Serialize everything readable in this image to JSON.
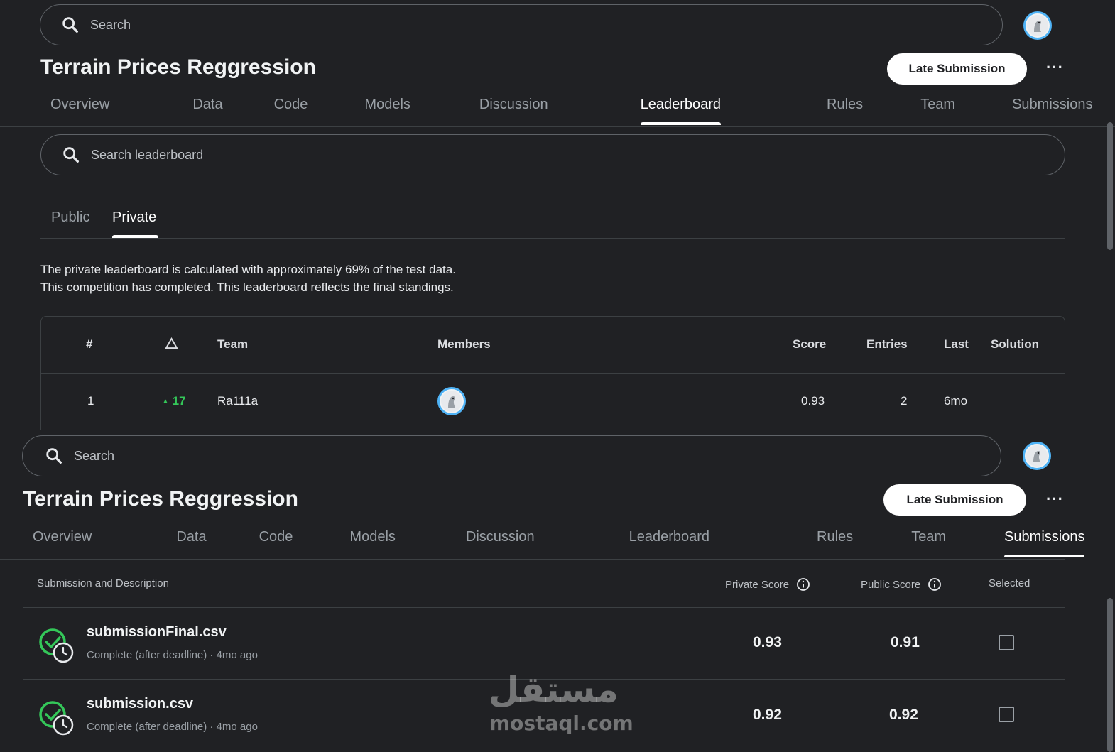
{
  "top": {
    "search_placeholder": "Search",
    "title": "Terrain Prices Reggression",
    "late_submission": "Late Submission",
    "more": "···",
    "tabs": [
      "Overview",
      "Data",
      "Code",
      "Models",
      "Discussion",
      "Leaderboard",
      "Rules",
      "Team",
      "Submissions"
    ],
    "active_tab": "Leaderboard",
    "leaderboard_search_placeholder": "Search leaderboard",
    "subtabs": [
      "Public",
      "Private"
    ],
    "active_subtab": "Private",
    "description_line1": "The private leaderboard is calculated with approximately 69% of the test data.",
    "description_line2": "This competition has completed. This leaderboard reflects the final standings.",
    "table": {
      "headers": [
        "#",
        "△",
        "Team",
        "Members",
        "Score",
        "Entries",
        "Last",
        "Solution"
      ],
      "rows": [
        {
          "rank": "1",
          "delta": "17",
          "team": "Ra111a",
          "score": "0.93",
          "entries": "2",
          "last": "6mo"
        }
      ]
    }
  },
  "bottom": {
    "search_placeholder": "Search",
    "title": "Terrain Prices Reggression",
    "late_submission": "Late Submission",
    "more": "···",
    "tabs": [
      "Overview",
      "Data",
      "Code",
      "Models",
      "Discussion",
      "Leaderboard",
      "Rules",
      "Team",
      "Submissions"
    ],
    "active_tab": "Submissions",
    "headers": {
      "submission": "Submission and Description",
      "private": "Private Score",
      "public": "Public Score",
      "selected": "Selected"
    },
    "rows": [
      {
        "file": "submissionFinal.csv",
        "status": "Complete (after deadline) · 4mo ago",
        "private": "0.93",
        "public": "0.91"
      },
      {
        "file": "submission.csv",
        "status": "Complete (after deadline) · 4mo ago",
        "private": "0.92",
        "public": "0.92"
      }
    ]
  },
  "watermark": {
    "arabic": "مستقل",
    "latin": "mostaql.com"
  },
  "colors": {
    "background": "#202124",
    "accent_green": "#34c759",
    "avatar_ring": "#4fb3f6"
  }
}
